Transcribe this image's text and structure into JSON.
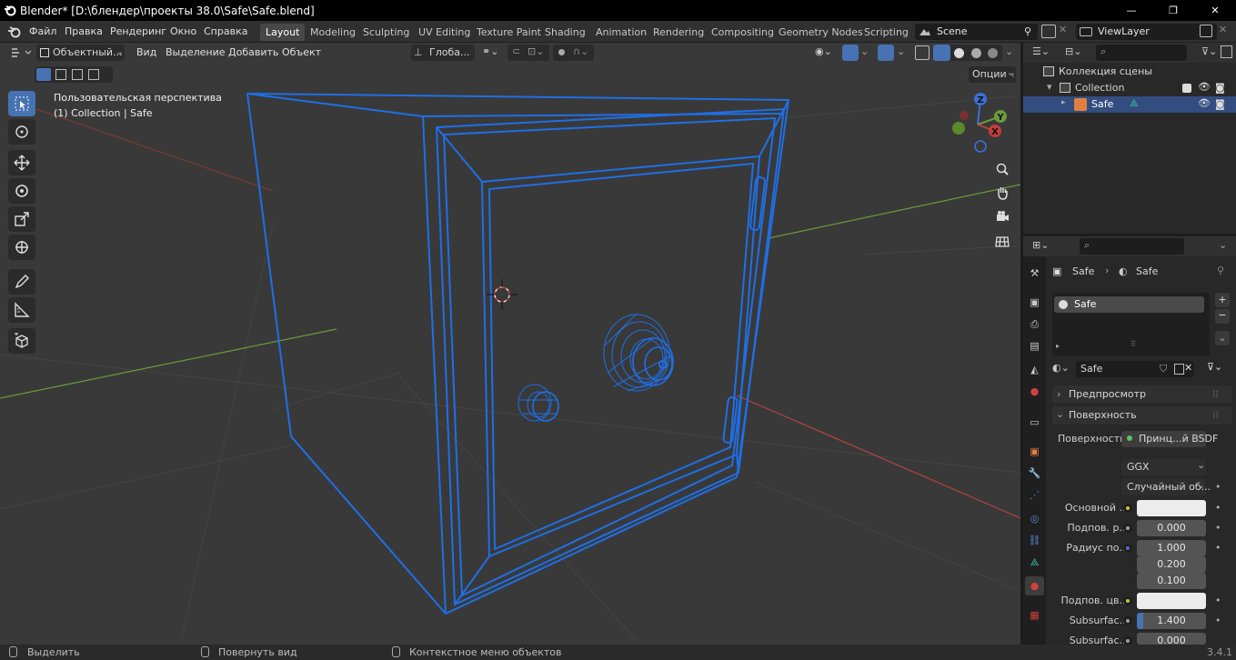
{
  "window": {
    "title": "Blender* [D:\\блендер\\проекты 38.0\\Safe\\Safe.blend]",
    "minimize": "—",
    "maximize": "❐",
    "close": "✕"
  },
  "menu": {
    "file": "Файл",
    "edit": "Правка",
    "render": "Рендеринг",
    "window": "Окно",
    "help": "Справка"
  },
  "workspaces": [
    "Layout",
    "Modeling",
    "Sculpting",
    "UV Editing",
    "Texture Paint",
    "Shading",
    "Animation",
    "Rendering",
    "Compositing",
    "Geometry Nodes",
    "Scripting"
  ],
  "scene": {
    "name": "Scene",
    "view_layer": "ViewLayer"
  },
  "viewport": {
    "mode": "Объектный...",
    "menu_view": "Вид",
    "menu_select": "Выделение",
    "menu_add": "Добавить",
    "menu_object": "Объект",
    "orientation": "Глоба...",
    "options": "Опции",
    "perspective": "Пользовательская перспектива",
    "collection_info": "(1) Collection | Safe",
    "gizmo": {
      "x": "X",
      "y": "Y",
      "z": "Z"
    }
  },
  "outliner": {
    "scene_collection": "Коллекция сцены",
    "collection": "Collection",
    "object": "Safe"
  },
  "properties": {
    "breadcrumb_object": "Safe",
    "breadcrumb_material": "Safe",
    "material_slot": "Safe",
    "material_name": "Safe",
    "panel_preview": "Предпросмотр",
    "panel_surface": "Поверхность",
    "surface_label": "Поверхность",
    "surface_value": "Принц...й BSDF",
    "distribution": "GGX",
    "subsurface_method": "Случайный об...",
    "base_color_label": "Основной ...",
    "subsurface_label": "Подпов. р...",
    "subsurface_value": "0.000",
    "radius_label": "Радиус по...",
    "radius_values": [
      "1.000",
      "0.200",
      "0.100"
    ],
    "subsurface_color_label": "Подпов. цв...",
    "subsurface_ior_label": "Subsurfac...",
    "subsurface_ior_value": "1.400",
    "subsurface_aniso_label": "Subsurfac...",
    "subsurface_aniso_value": "0.000"
  },
  "statusbar": {
    "select": "Выделить",
    "rotate": "Повернуть вид",
    "context": "Контекстное меню объектов",
    "version": "3.4.1"
  },
  "colors": {
    "accent": "#4772b3",
    "wire": "#1f6fe6",
    "axis_x": "#b5443f",
    "axis_y": "#6b9a3a"
  }
}
